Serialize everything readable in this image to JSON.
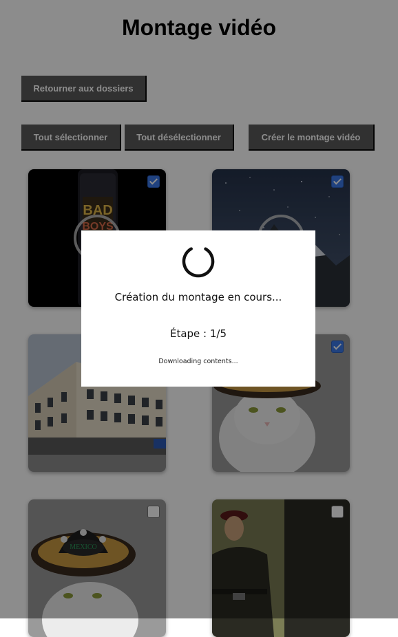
{
  "page": {
    "title": "Montage vidéo"
  },
  "toolbar": {
    "back_label": "Retourner aux dossiers",
    "select_all_label": "Tout sélectionner",
    "deselect_all_label": "Tout désélectionner",
    "create_label": "Créer le montage vidéo"
  },
  "gallery": {
    "items": [
      {
        "kind": "video",
        "icon": "phone-poster-thumbnail",
        "checked": true
      },
      {
        "kind": "video",
        "icon": "night-sky-mountain-thumbnail",
        "checked": true
      },
      {
        "kind": "image",
        "icon": "building-photo-thumbnail",
        "checked": false
      },
      {
        "kind": "image",
        "icon": "cat-sombrero-thumbnail",
        "checked": true
      },
      {
        "kind": "image",
        "icon": "cat-sombrero-thumbnail",
        "checked": false
      },
      {
        "kind": "image",
        "icon": "soldier-character-thumbnail",
        "checked": false
      }
    ]
  },
  "modal": {
    "message": "Création du montage en cours...",
    "step": "Étape : 1/5",
    "detail": "Downloading contents..."
  },
  "colors": {
    "overlay": "#000000",
    "button_bg": "#5a5a5a",
    "checkbox_checked": "#3b78e7"
  }
}
